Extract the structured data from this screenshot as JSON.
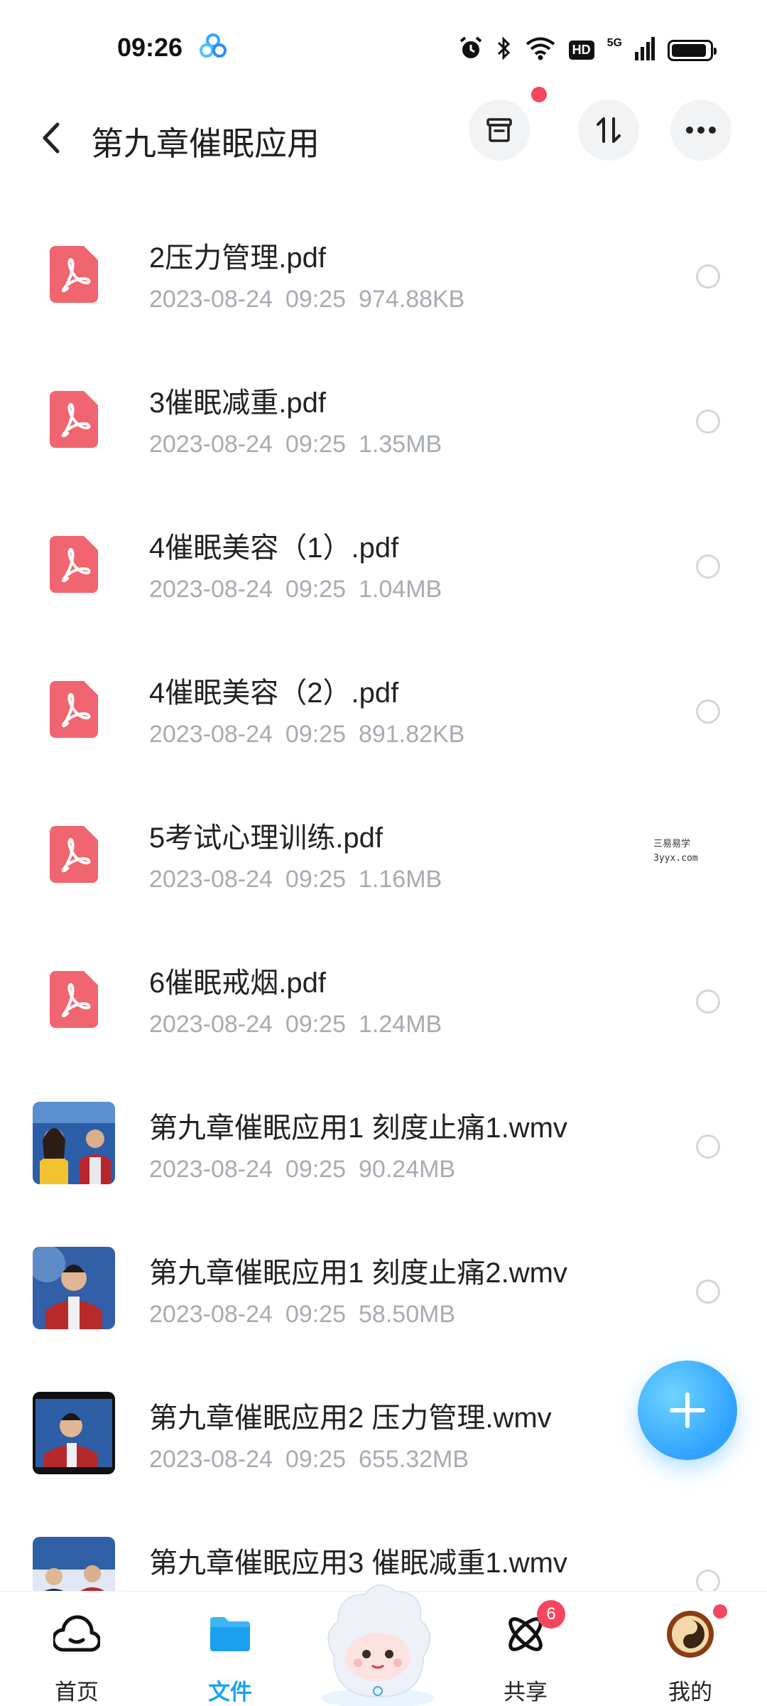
{
  "status_bar": {
    "time": "09:26",
    "hd_label": "HD",
    "network_label": "5G",
    "icons": [
      "app-cluster-icon",
      "alarm-icon",
      "bluetooth-icon",
      "wifi-icon",
      "signal-icon",
      "battery-icon"
    ]
  },
  "header": {
    "title": "第九章催眠应用",
    "buttons": [
      "back-icon",
      "archive-icon",
      "sort-icon",
      "more-icon"
    ]
  },
  "files": [
    {
      "name": "2压力管理.pdf",
      "date": "2023-08-24",
      "time": "09:25",
      "size": "974.88KB",
      "kind": "pdf"
    },
    {
      "name": "3催眠减重.pdf",
      "date": "2023-08-24",
      "time": "09:25",
      "size": "1.35MB",
      "kind": "pdf"
    },
    {
      "name": "4催眠美容（1）.pdf",
      "date": "2023-08-24",
      "time": "09:25",
      "size": "1.04MB",
      "kind": "pdf"
    },
    {
      "name": "4催眠美容（2）.pdf",
      "date": "2023-08-24",
      "time": "09:25",
      "size": "891.82KB",
      "kind": "pdf"
    },
    {
      "name": "5考试心理训练.pdf",
      "date": "2023-08-24",
      "time": "09:25",
      "size": "1.16MB",
      "kind": "pdf"
    },
    {
      "name": "6催眠戒烟.pdf",
      "date": "2023-08-24",
      "time": "09:25",
      "size": "1.24MB",
      "kind": "pdf"
    },
    {
      "name": "第九章催眠应用1 刻度止痛1.wmv",
      "date": "2023-08-24",
      "time": "09:25",
      "size": "90.24MB",
      "kind": "video"
    },
    {
      "name": "第九章催眠应用1 刻度止痛2.wmv",
      "date": "2023-08-24",
      "time": "09:25",
      "size": "58.50MB",
      "kind": "video"
    },
    {
      "name": "第九章催眠应用2 压力管理.wmv",
      "date": "2023-08-24",
      "time": "09:25",
      "size": "655.32MB",
      "kind": "video"
    },
    {
      "name": "第九章催眠应用3 催眠减重1.wmv",
      "date": "",
      "time": "",
      "size": "",
      "kind": "video"
    }
  ],
  "watermark": {
    "line1": "三易易学",
    "line2": "3yyx.com"
  },
  "fab": {
    "icon": "plus-icon"
  },
  "bottom_nav": {
    "items": [
      {
        "label": "首页",
        "icon": "cloud-home-icon"
      },
      {
        "label": "文件",
        "icon": "folder-icon"
      },
      {
        "label": "",
        "icon": "mascot-icon"
      },
      {
        "label": "共享",
        "icon": "atom-share-icon",
        "badge": "6"
      },
      {
        "label": "我的",
        "icon": "avatar-icon"
      }
    ]
  },
  "colors": {
    "accent": "#16a4f2",
    "pdf_red": "#f06570",
    "badge_red": "#f5465f",
    "meta_gray": "#a7abb2"
  }
}
